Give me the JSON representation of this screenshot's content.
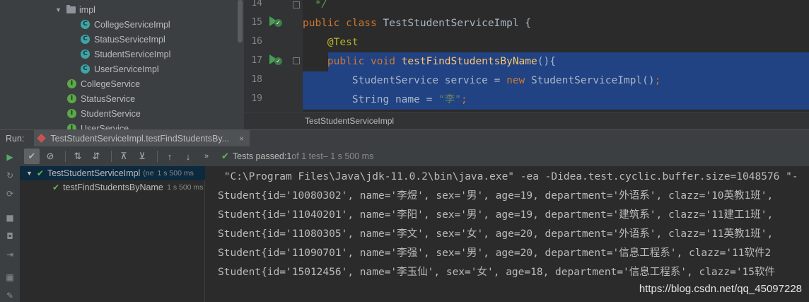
{
  "project_tree": {
    "folder": "impl",
    "impl_items": [
      "CollegeServiceImpl",
      "StatusServiceImpl",
      "StudentServiceImpl",
      "UserServiceImpl"
    ],
    "interface_items": [
      "CollegeService",
      "StatusService",
      "StudentService",
      "UserService"
    ],
    "class_letter": "C",
    "interface_letter": "I"
  },
  "editor": {
    "line_numbers": [
      "14",
      "15",
      "16",
      "17",
      "18",
      "19"
    ],
    "lines": [
      [
        {
          "t": "  */",
          "c": "cm"
        }
      ],
      [
        {
          "t": "public class ",
          "c": "kw"
        },
        {
          "t": "TestStudentServiceImpl {",
          "c": "tx"
        }
      ],
      [
        {
          "t": "    ",
          "c": "tx"
        },
        {
          "t": "@Test",
          "c": "ann"
        }
      ],
      [
        {
          "t": "    ",
          "c": "tx"
        },
        {
          "t": "public void ",
          "c": "kw"
        },
        {
          "t": "testFindStudentsByName",
          "c": "fn"
        },
        {
          "t": "(){",
          "c": "tx"
        }
      ],
      [
        {
          "t": "        StudentService service = ",
          "c": "tx"
        },
        {
          "t": "new ",
          "c": "kw"
        },
        {
          "t": "StudentServiceImpl()",
          "c": "tx"
        },
        {
          "t": ";",
          "c": "kw"
        }
      ],
      [
        {
          "t": "        String name = ",
          "c": "tx"
        },
        {
          "t": "\"李\"",
          "c": "str"
        },
        {
          "t": ";",
          "c": "kw"
        }
      ]
    ],
    "breadcrumb": "TestStudentServiceImpl"
  },
  "run": {
    "label": "Run:",
    "tab_title": "TestStudentServiceImpl.testFindStudentsBy...",
    "tab_close": "×",
    "status_prefix": "Tests passed: ",
    "status_count": "1",
    "status_of": " of 1 test",
    "status_time": " – 1 s 500 ms"
  },
  "results": {
    "root_name": "TestStudentServiceImpl",
    "root_suffix": "(ne",
    "root_time": "1 s 500 ms",
    "child_name": "testFindStudentsByName",
    "child_time": "1 s 500 ms"
  },
  "console": {
    "lines": [
      " \"C:\\Program Files\\Java\\jdk-11.0.2\\bin\\java.exe\" -ea -Didea.test.cyclic.buffer.size=1048576 \"-",
      "Student{id='10080302', name='李煜', sex='男', age=19, department='外语系', clazz='10英教1班',",
      "Student{id='11040201', name='李阳', sex='男', age=19, department='建筑系', clazz='11建工1班',",
      "Student{id='11080305', name='李文', sex='女', age=20, department='外语系', clazz='11英教1班',",
      "Student{id='11090701', name='李强', sex='男', age=20, department='信息工程系', clazz='11软件2",
      "Student{id='15012456', name='李玉仙', sex='女', age=18, department='信息工程系', clazz='15软件"
    ],
    "watermark": "https://blog.csdn.net/qq_45097228"
  }
}
